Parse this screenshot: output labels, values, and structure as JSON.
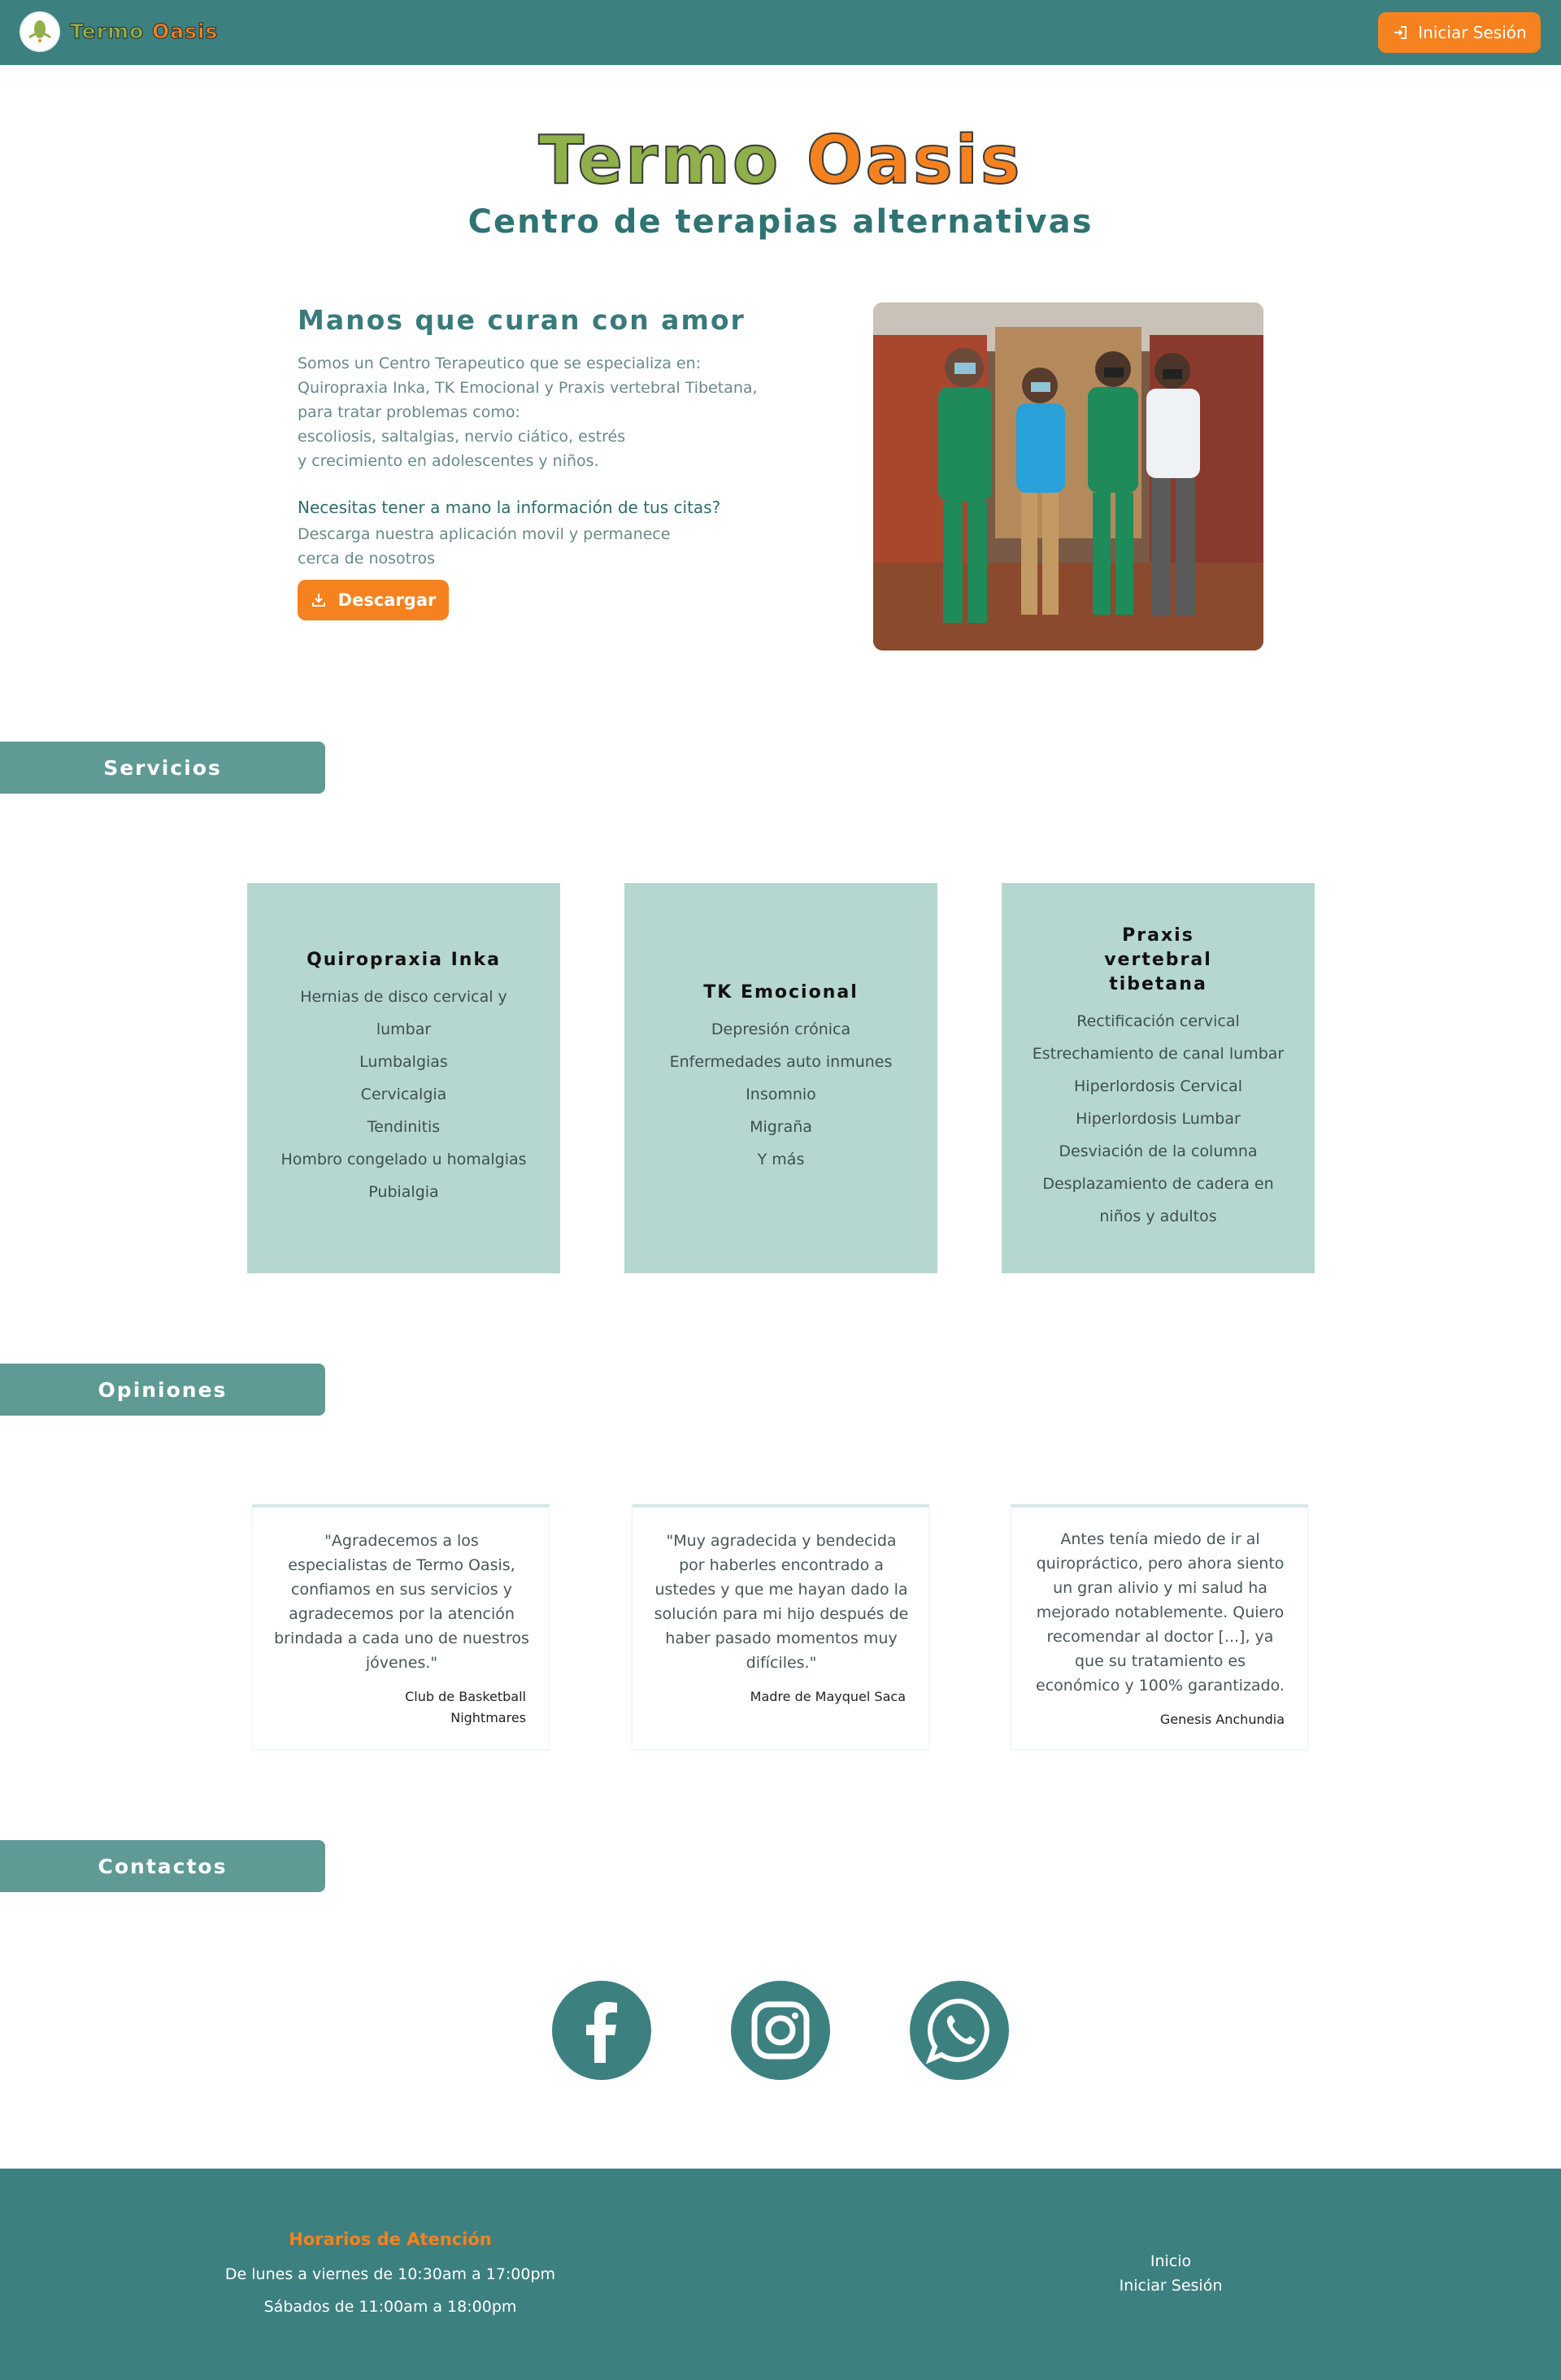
{
  "nav": {
    "brand_word1": "Termo",
    "brand_word2": "Oasis",
    "login_label": "Iniciar Sesión",
    "icons": [
      "lotus-logo",
      "login-icon"
    ]
  },
  "hero": {
    "title_word1": "Termo",
    "title_word2": "Oasis",
    "subtitle": "Centro de terapias alternativas"
  },
  "intro": {
    "title": "Manos que curan con amor",
    "lines": [
      "Somos un Centro Terapeutico que se especializa en:",
      "Quiropraxia Inka, TK Emocional y Praxis vertebral Tibetana,",
      "para tratar problemas como:",
      "escoliosis, saltalgias, nervio ciático, estrés",
      "y crecimiento en adolescentes y niños."
    ],
    "question": "Necesitas tener a mano la información de tus citas?",
    "app_lines": [
      "Descarga nuestra aplicación movil y permanece",
      "cerca de nosotros"
    ],
    "download_label": "Descargar"
  },
  "sections": {
    "services": "Servicios",
    "opinions": "Opiniones",
    "contacts": "Contactos"
  },
  "services": [
    {
      "title": "Quiropraxia Inka",
      "items": [
        "Hernias de disco cervical y lumbar",
        "Lumbalgias",
        "Cervicalgia",
        "Tendinitis",
        "Hombro congelado u homalgias",
        "Pubialgia"
      ]
    },
    {
      "title": "TK Emocional",
      "items": [
        "Depresión crónica",
        "Enfermedades auto inmunes",
        "Insomnio",
        "Migraña",
        "Y más"
      ]
    },
    {
      "title": "Praxis vertebral tibetana",
      "items": [
        "Rectificación cervical",
        "Estrechamiento de canal lumbar",
        "Hiperlordosis Cervical",
        "Hiperlordosis Lumbar",
        "Desviación de la columna",
        "Desplazamiento de cadera en niños y adultos"
      ]
    }
  ],
  "testimonials": [
    {
      "quote": "\"Agradecemos a los especialistas de Termo Oasis, confiamos en sus servicios y agradecemos por la atención brindada a cada uno de nuestros jóvenes.\"",
      "author": "Club de Basketball Nightmares"
    },
    {
      "quote": "\"Muy agradecida y bendecida por haberles encontrado a ustedes y que me hayan dado la solución para mi hijo después de haber pasado momentos muy difíciles.\"",
      "author": "Madre de Mayquel Saca"
    },
    {
      "quote": "Antes tenía miedo de ir al quiropráctico, pero ahora siento un gran alivio y mi salud ha mejorado notablemente. Quiero recomendar al doctor [...], ya que su tratamiento es económico y 100% garantizado.",
      "author": "Genesis Anchundia"
    }
  ],
  "social": [
    "facebook-icon",
    "instagram-icon",
    "whatsapp-icon"
  ],
  "footer": {
    "hours_title": "Horarios de Atención",
    "hours_weekdays": "De lunes a viernes de 10:30am a 17:00pm",
    "hours_saturday": "Sábados de 11:00am a 18:00pm",
    "link_home": "Inicio",
    "link_login": "Iniciar Sesión"
  },
  "colors": {
    "primary": "#3d8080",
    "accent": "#f5821f",
    "green": "#8fb04a",
    "card_bg": "#b6d6d0",
    "tab_bg": "#5f9a95"
  }
}
